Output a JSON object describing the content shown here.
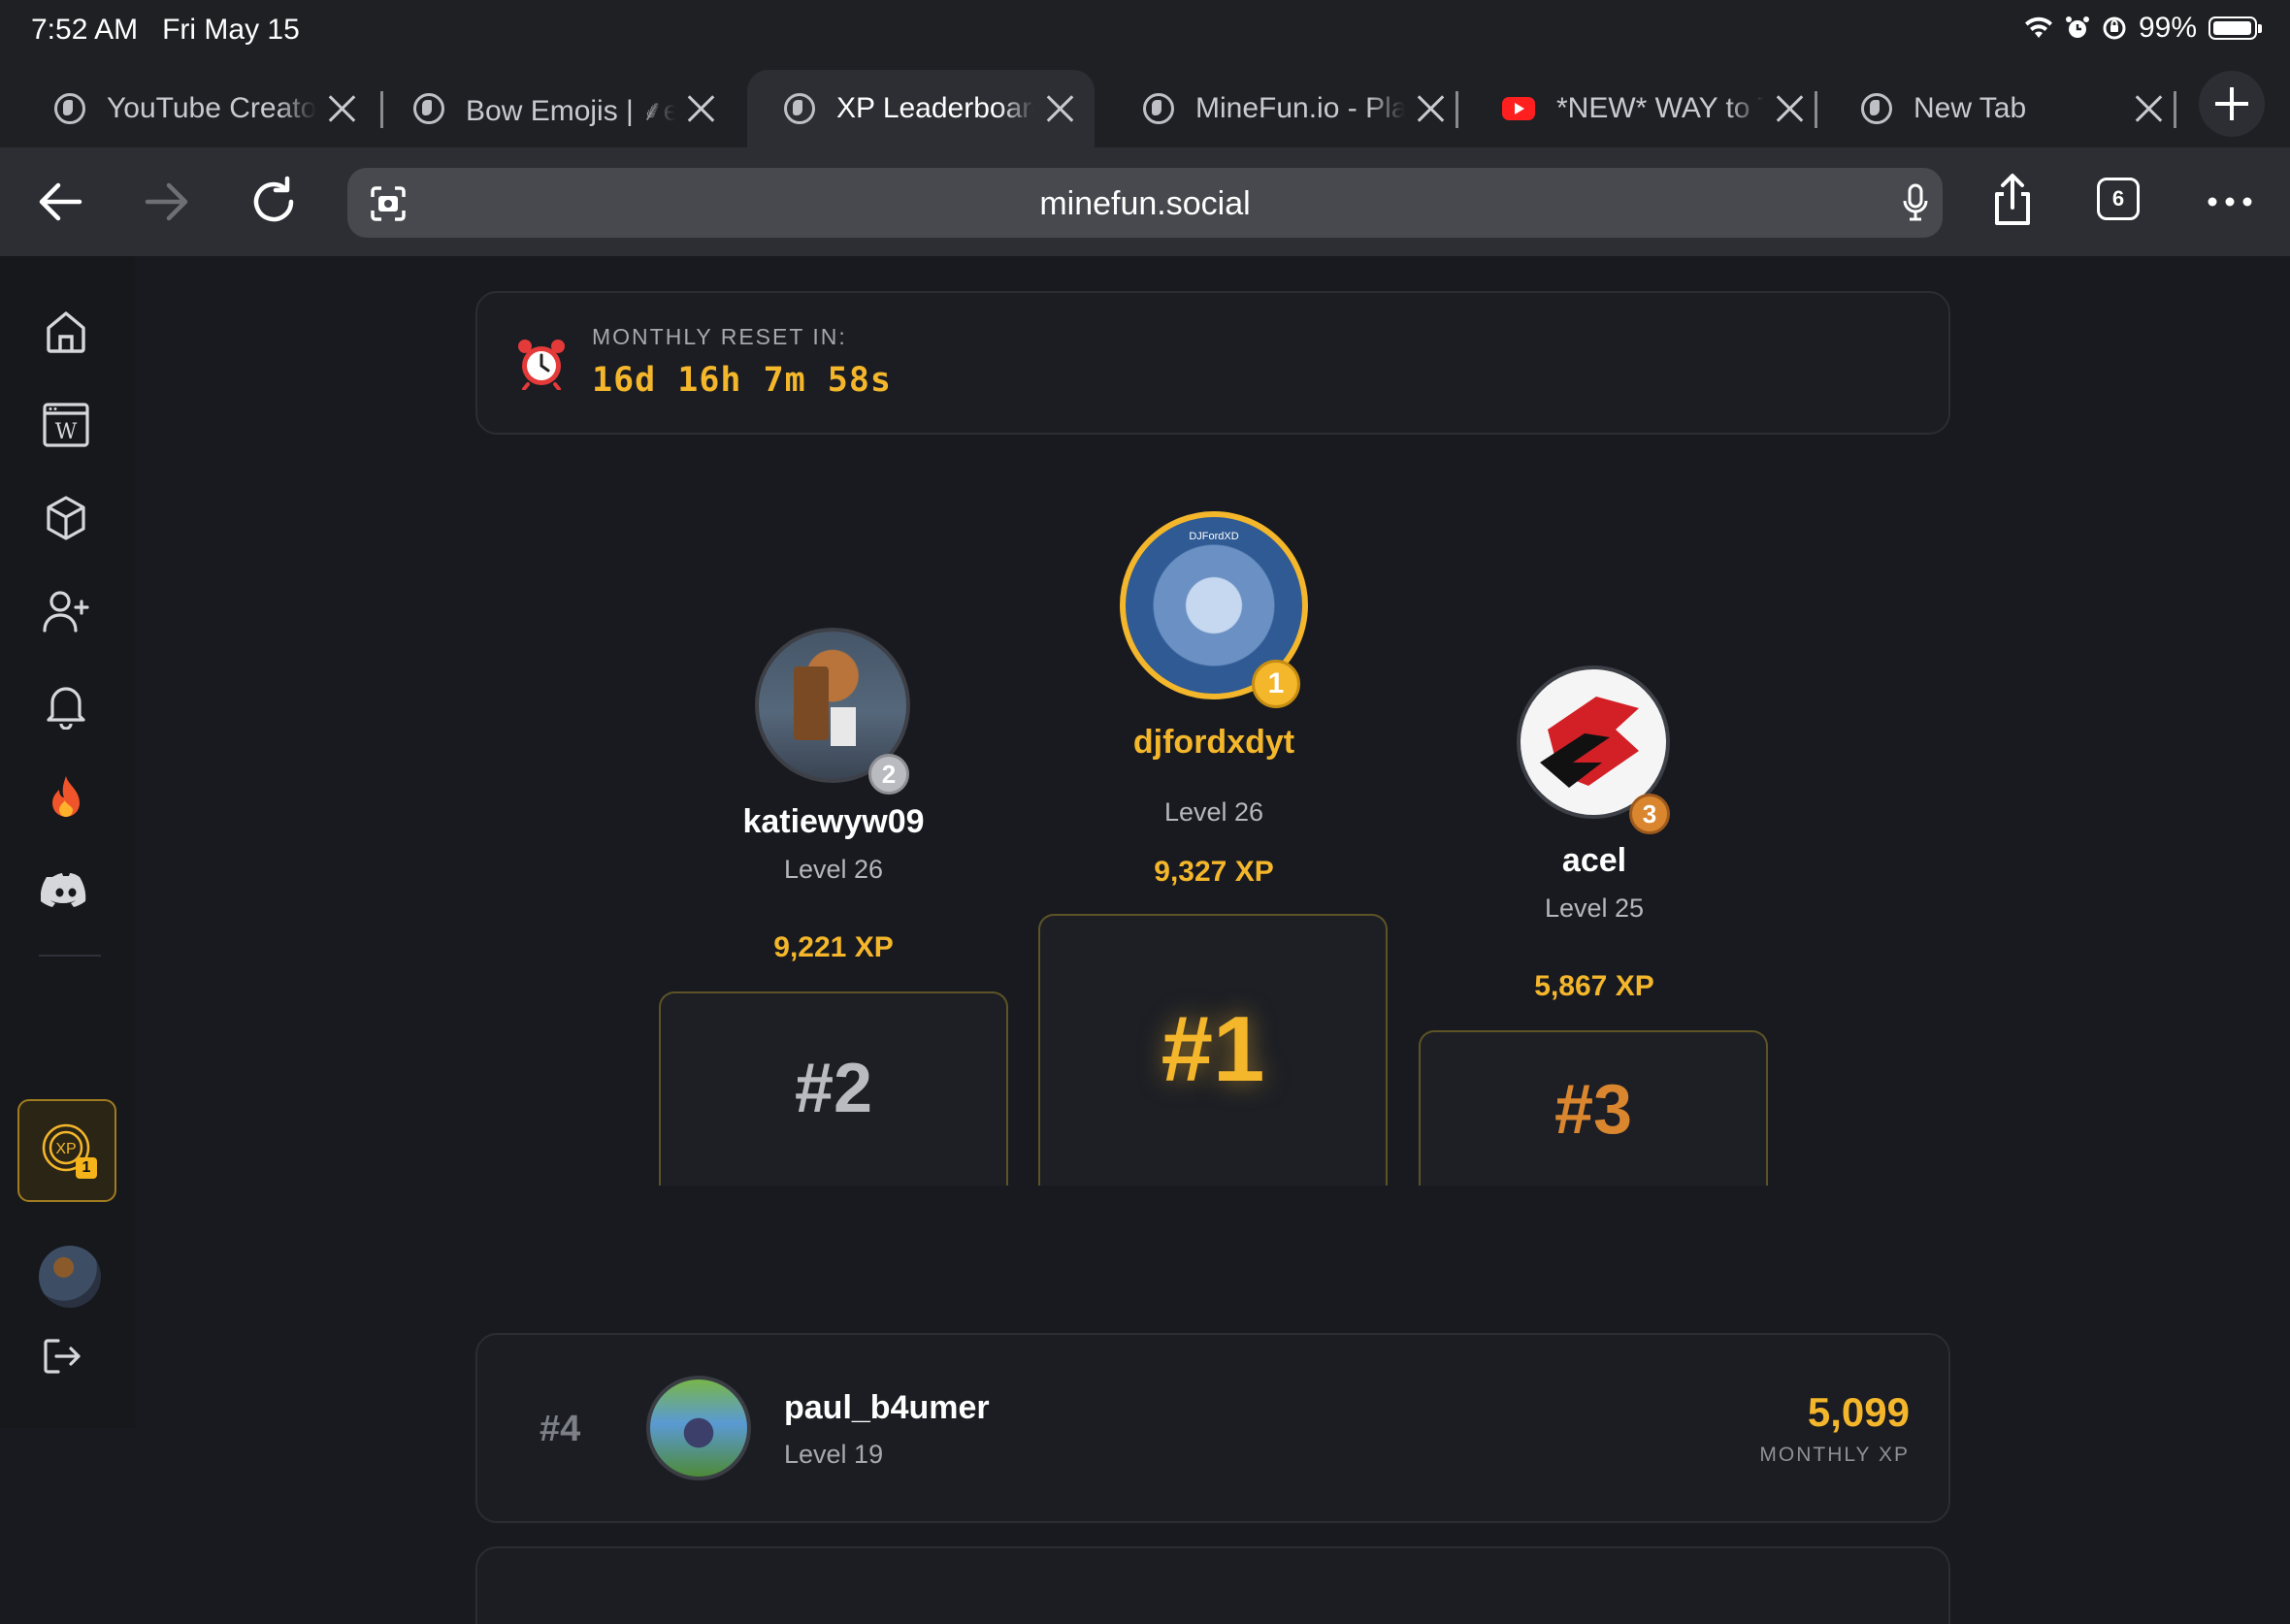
{
  "status": {
    "time": "7:52 AM",
    "date": "Fri May 15",
    "battery": "99%"
  },
  "tabs": [
    {
      "title": "YouTube Creato",
      "icon": "globe-icon"
    },
    {
      "title": "Bow Emojis | ⸙e",
      "icon": "globe-icon"
    },
    {
      "title": "XP Leaderboard",
      "icon": "globe-icon",
      "active": true
    },
    {
      "title": "MineFun.io - Pla",
      "icon": "globe-icon"
    },
    {
      "title": "*NEW* WAY to T",
      "icon": "youtube-icon"
    },
    {
      "title": "New Tab",
      "icon": "globe-icon"
    }
  ],
  "browser": {
    "url": "minefun.social",
    "tab_count": "6"
  },
  "sidebar": {
    "xp_badge": "1",
    "xp_label": "XP"
  },
  "reset": {
    "label": "MONTHLY RESET IN:",
    "value": "16d 16h 7m 58s"
  },
  "podium": {
    "first": {
      "name": "djfordxdyt",
      "level": "Level 26",
      "xp": "9,327 XP",
      "rank": "#1",
      "medal": "1",
      "avatar_caption": "DJFordXD"
    },
    "second": {
      "name": "katiewyw09",
      "level": "Level 26",
      "xp": "9,221 XP",
      "rank": "#2",
      "medal": "2"
    },
    "third": {
      "name": "acel",
      "level": "Level 25",
      "xp": "5,867 XP",
      "rank": "#3",
      "medal": "3"
    }
  },
  "list": [
    {
      "rank": "#4",
      "name": "paul_b4umer",
      "level": "Level 19",
      "xp": "5,099",
      "xp_label": "MONTHLY XP"
    }
  ],
  "colors": {
    "gold": "#f4b62b",
    "silver": "#b9bbc0",
    "bronze": "#d9862f",
    "bg": "#181a1f"
  }
}
